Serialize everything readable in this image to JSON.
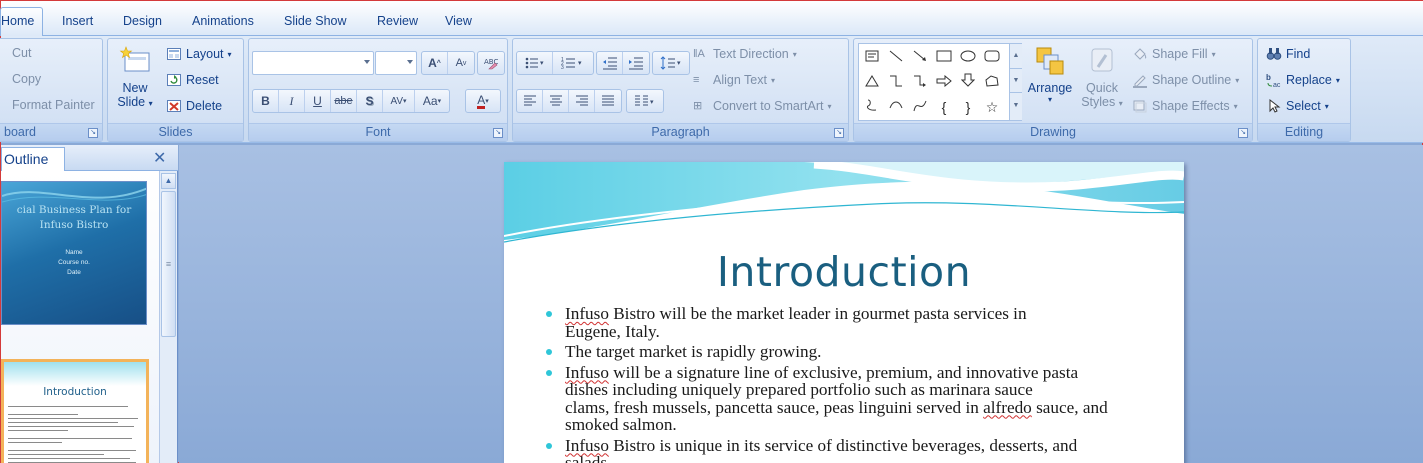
{
  "tabs": [
    "Home",
    "Insert",
    "Design",
    "Animations",
    "Slide Show",
    "Review",
    "View"
  ],
  "clipboard": {
    "label": "Clipboard",
    "label_visible": "board",
    "cut": "Cut",
    "copy": "Copy",
    "format_painter": "Format Painter"
  },
  "slides_group": {
    "label": "Slides",
    "new_slide_line1": "New",
    "new_slide_line2": "Slide",
    "layout": "Layout",
    "reset": "Reset",
    "delete": "Delete"
  },
  "font_group": {
    "label": "Font",
    "font_name_value": "",
    "font_size_value": "",
    "buttons": [
      "B",
      "I",
      "U",
      "abe",
      "S",
      "AV",
      "Aa",
      "A"
    ]
  },
  "paragraph_group": {
    "label": "Paragraph",
    "text_direction": "Text Direction",
    "align_text": "Align Text",
    "convert_smartart": "Convert to SmartArt"
  },
  "drawing_group": {
    "label": "Drawing",
    "arrange": "Arrange",
    "quick_styles_line1": "Quick",
    "quick_styles_line2": "Styles",
    "shape_fill": "Shape Fill",
    "shape_outline": "Shape Outline",
    "shape_effects": "Shape Effects"
  },
  "editing_group": {
    "label": "Editing",
    "find": "Find",
    "replace": "Replace",
    "select": "Select"
  },
  "left_panel": {
    "tab_outline": "Outline",
    "thumb1": {
      "title": "cial Business Plan for",
      "subtitle": "Infuso Bistro",
      "name": "Name",
      "course": "Course no.",
      "date": "Date"
    },
    "thumb2": {
      "title": "Introduction"
    }
  },
  "slide": {
    "title": "Introduction",
    "bullets": [
      {
        "lines": [
          [
            "Infuso",
            " Bistro will be the market leader in gourmet pasta services in"
          ],
          [
            "",
            "Eugene, Italy."
          ]
        ]
      },
      {
        "lines": [
          [
            "",
            "The target market is rapidly growing."
          ]
        ]
      },
      {
        "lines": [
          [
            "Infuso",
            " will be a signature line of exclusive, premium, and innovative pasta"
          ],
          [
            "",
            "dishes including uniquely prepared portfolio such as marinara sauce"
          ],
          [
            "",
            "clams, fresh mussels, pancetta sauce, peas linguini served in alfredo sauce, and"
          ],
          [
            "",
            "smoked salmon."
          ]
        ]
      },
      {
        "lines": [
          [
            "Infuso",
            " Bistro is unique in its service of distinctive beverages, desserts, and"
          ],
          [
            "",
            "salads."
          ]
        ]
      }
    ]
  },
  "colors": {
    "accent": "#1a5f80",
    "bullet": "#2fc6d8",
    "ribbon": "#dfeaf8",
    "canvas": "#8aa9d6"
  }
}
